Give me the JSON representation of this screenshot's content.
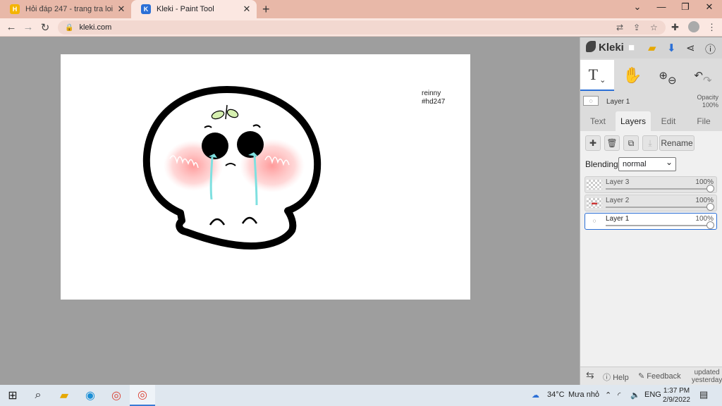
{
  "browser": {
    "tabs": [
      {
        "title": "Hỏi đáp 247 - trang tra loi",
        "active": false
      },
      {
        "title": "Kleki - Paint Tool",
        "active": true
      }
    ],
    "url": "kleki.com",
    "colors": {
      "tabbar": "#e8b8a8",
      "active_tab": "#fbe7e1"
    }
  },
  "canvas": {
    "signature_line1": "reinny",
    "signature_line2": "#hd247"
  },
  "panel": {
    "logo": "Kleki",
    "current_layer": {
      "name": "Layer 1",
      "opacity_label": "Opacity",
      "opacity_value": "100%"
    },
    "tabs": [
      "Text",
      "Layers",
      "Edit",
      "File"
    ],
    "active_tab": "Layers",
    "rename_label": "Rename",
    "blending_label": "Blending",
    "blending_value": "normal",
    "layers": [
      {
        "name": "Layer 3",
        "opacity": "100%",
        "active": false
      },
      {
        "name": "Layer 2",
        "opacity": "100%",
        "active": false
      },
      {
        "name": "Layer 1",
        "opacity": "100%",
        "active": true
      }
    ],
    "footer": {
      "help": "Help",
      "feedback": "Feedback",
      "updated_line1": "updated",
      "updated_line2": "yesterday"
    },
    "accent": "#2b6fd6"
  },
  "taskbar": {
    "weather_temp": "34°C",
    "weather_text": "Mưa nhỏ",
    "language": "ENG",
    "time": "1:37 PM",
    "date": "2/9/2022"
  }
}
